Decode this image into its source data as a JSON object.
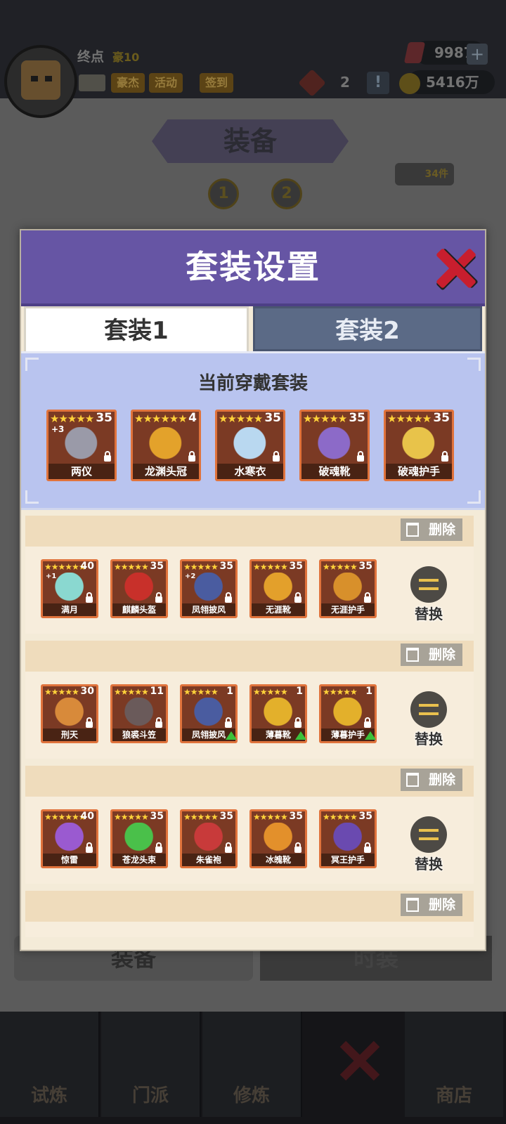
{
  "player": {
    "name": "终点",
    "rank": "豪10"
  },
  "top_chips": [
    "豪杰",
    "活动",
    "签到"
  ],
  "resources": {
    "gems": "9987",
    "tokens": "2",
    "coins": "5416万",
    "plus": "+",
    "alert": "!"
  },
  "screen": {
    "title": "装备",
    "pages": [
      "1",
      "2"
    ],
    "item_count": "34件"
  },
  "bottom_tabs": [
    "装备",
    "时装"
  ],
  "nav": [
    "试炼",
    "门派",
    "修炼",
    "商店"
  ],
  "modal": {
    "title": "套装设置",
    "tabs": [
      "套装1",
      "套装2"
    ],
    "current_title": "当前穿戴套装",
    "current_items": [
      {
        "name": "两仪",
        "level": "35",
        "plus": "+3",
        "stars": "★★★★★",
        "color": "#9a9aa8"
      },
      {
        "name": "龙渊头冠",
        "level": "4",
        "plus": "",
        "stars": "★★★★★★",
        "color": "#e3a22b"
      },
      {
        "name": "水寒衣",
        "level": "35",
        "plus": "",
        "stars": "★★★★★",
        "color": "#b9d8f0"
      },
      {
        "name": "破魂靴",
        "level": "35",
        "plus": "",
        "stars": "★★★★★",
        "color": "#8c6ac8"
      },
      {
        "name": "破魂护手",
        "level": "35",
        "plus": "",
        "stars": "★★★★★",
        "color": "#e8c34a"
      }
    ],
    "delete_label": "删除",
    "swap_label": "替换",
    "sets": [
      {
        "items": [
          {
            "name": "满月",
            "level": "40",
            "plus": "+1",
            "stars": "★★★★★★",
            "color": "#8ad8d0",
            "upgrade": false
          },
          {
            "name": "麒麟头盔",
            "level": "35",
            "plus": "",
            "stars": "★★★★★",
            "color": "#c8302a",
            "upgrade": false
          },
          {
            "name": "凤翎披风",
            "level": "35",
            "plus": "+2",
            "stars": "★★★★★",
            "color": "#4a5ca0",
            "upgrade": false
          },
          {
            "name": "无涯靴",
            "level": "35",
            "plus": "",
            "stars": "★★★★★",
            "color": "#e3a02b",
            "upgrade": false
          },
          {
            "name": "无涯护手",
            "level": "35",
            "plus": "",
            "stars": "★★★★★",
            "color": "#d8902b",
            "upgrade": false
          }
        ]
      },
      {
        "items": [
          {
            "name": "刑天",
            "level": "30",
            "plus": "",
            "stars": "★★★★★",
            "color": "#d88a3a",
            "upgrade": false
          },
          {
            "name": "狼裘斗笠",
            "level": "11",
            "plus": "",
            "stars": "★★★★★",
            "color": "#6a5a5a",
            "upgrade": false
          },
          {
            "name": "凤翎披风",
            "level": "1",
            "plus": "",
            "stars": "★★★★★",
            "color": "#4a5ca0",
            "upgrade": true
          },
          {
            "name": "薄暮靴",
            "level": "1",
            "plus": "",
            "stars": "★★★★★",
            "color": "#e3b02b",
            "upgrade": true
          },
          {
            "name": "薄暮护手",
            "level": "1",
            "plus": "",
            "stars": "★★★★★",
            "color": "#e3b02b",
            "upgrade": true
          }
        ]
      },
      {
        "items": [
          {
            "name": "惊雷",
            "level": "40",
            "plus": "",
            "stars": "★★★★★★",
            "color": "#9a5ad0",
            "upgrade": false
          },
          {
            "name": "苍龙头束",
            "level": "35",
            "plus": "",
            "stars": "★★★★★",
            "color": "#4ac04a",
            "upgrade": false
          },
          {
            "name": "朱雀袍",
            "level": "35",
            "plus": "",
            "stars": "★★★★★",
            "color": "#c83a3a",
            "upgrade": false
          },
          {
            "name": "冰魄靴",
            "level": "35",
            "plus": "",
            "stars": "★★★★★",
            "color": "#e3902b",
            "upgrade": false
          },
          {
            "name": "冥王护手",
            "level": "35",
            "plus": "",
            "stars": "★★★★★",
            "color": "#6a4ab0",
            "upgrade": false
          }
        ]
      },
      {
        "items": []
      }
    ]
  }
}
